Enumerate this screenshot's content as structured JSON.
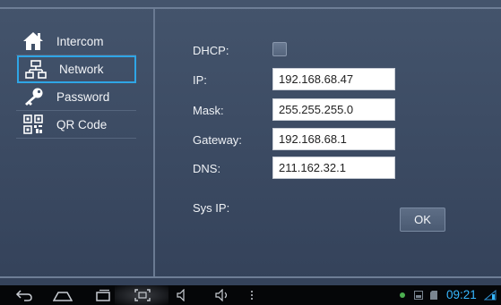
{
  "sidebar": {
    "items": [
      {
        "label": "Intercom",
        "icon": "home-icon"
      },
      {
        "label": "Network",
        "icon": "network-icon",
        "active": true
      },
      {
        "label": "Password",
        "icon": "key-icon"
      },
      {
        "label": "QR Code",
        "icon": "qr-code-icon"
      }
    ]
  },
  "form": {
    "dhcp_label": "DHCP:",
    "dhcp_checked": false,
    "ip_label": "IP:",
    "ip_value": "192.168.68.47",
    "mask_label": "Mask:",
    "mask_value": "255.255.255.0",
    "gateway_label": "Gateway:",
    "gateway_value": "192.168.68.1",
    "dns_label": "DNS:",
    "dns_value": "211.162.32.1",
    "sysip_label": "Sys IP:",
    "sysip_value": "",
    "ok_label": "OK"
  },
  "navbar": {
    "icons": [
      "back-icon",
      "home-icon",
      "recent-apps-icon",
      "screenshot-icon",
      "volume-down-icon",
      "volume-up-icon",
      "menu-icon"
    ],
    "status_icons": [
      "notification-dot-icon",
      "gallery-icon",
      "sd-card-icon",
      "wifi-icon"
    ],
    "clock": "09:21"
  },
  "colors": {
    "accent": "#2fa6e6",
    "background": "#3e4e66",
    "clock": "#36b7ff"
  }
}
